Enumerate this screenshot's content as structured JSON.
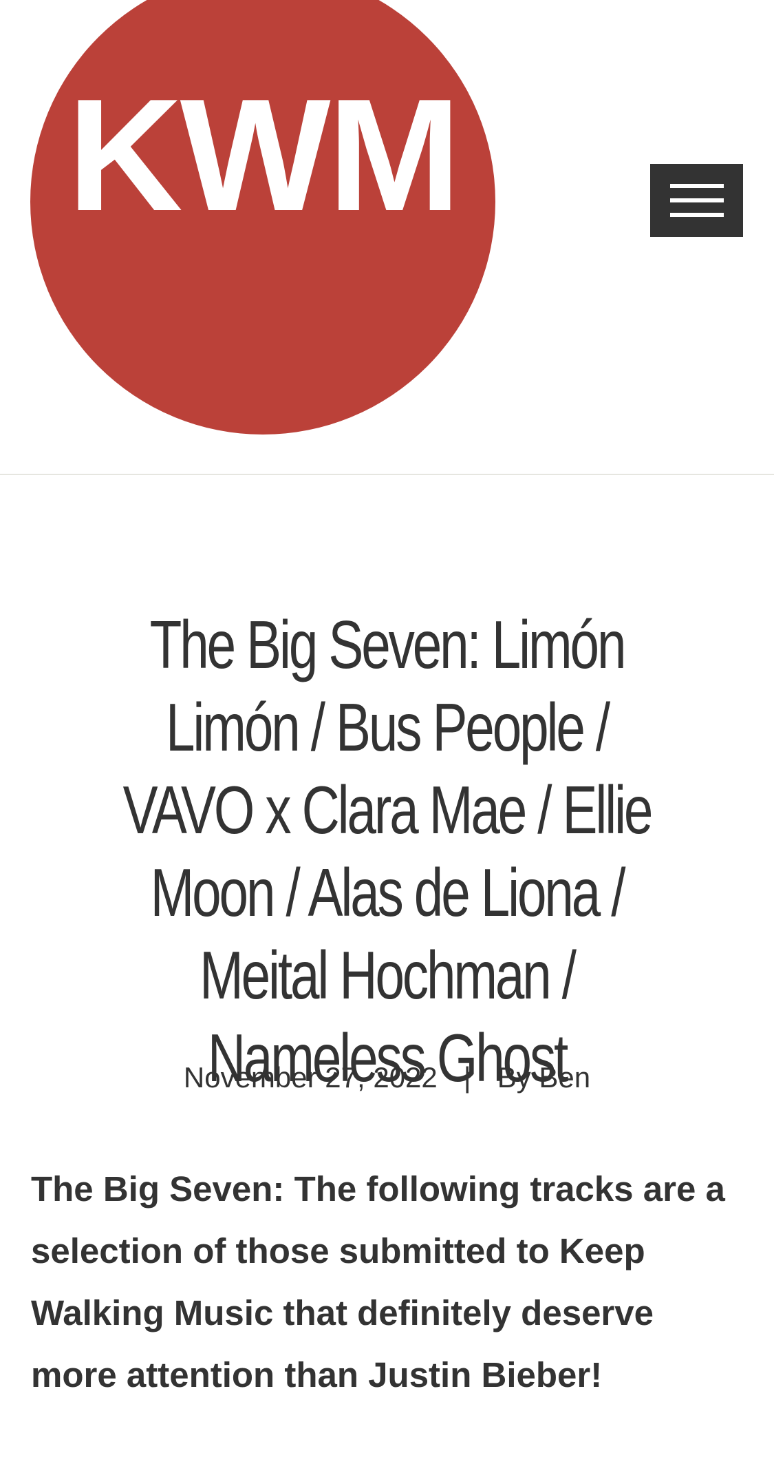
{
  "header": {
    "logo_text": "KWM",
    "menu_icon": "hamburger-menu-icon"
  },
  "post": {
    "title": "The Big Seven: Limón Limón / Bus People / VAVO x Clara Mae / Ellie Moon / Alas de Liona / Meital Hochman / Nameless Ghost",
    "date": "November 27, 2022",
    "separator": "|",
    "author_prefix": "By",
    "author": "Ben",
    "intro": "The Big Seven: The following tracks are a selection of those submitted to Keep Walking Music that definitely deserve more attention than Justin Bieber!"
  },
  "colors": {
    "logo_red": "#bb4139",
    "menu_button": "#333333",
    "text": "#333333",
    "divider": "#e6e6e0"
  }
}
